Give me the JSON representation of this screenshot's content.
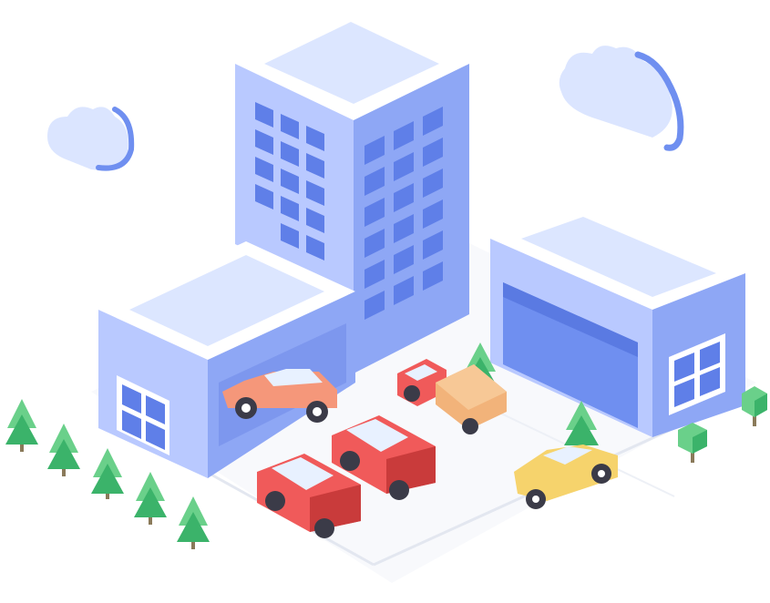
{
  "scene": {
    "description_free": true,
    "palette": {
      "background": "#ffffff",
      "ground": "#f7f8fb",
      "ground_line": "#e6e9f2",
      "building_top": "#dce6ff",
      "building_top_rim": "#eef3ff",
      "building_left": "#b9c9ff",
      "building_right": "#8ea7f5",
      "window": "#5f7fe8",
      "window_frame": "#ffffff",
      "cloud": "#dbe5ff",
      "cloud_shadow": "#6f8ff0",
      "tree_light": "#6ad08a",
      "tree_dark": "#3bb36a",
      "trunk": "#8a7a5a",
      "car_red": "#f05a5a",
      "car_red_dark": "#c93b3b",
      "car_coral": "#f5977a",
      "car_yellow": "#f6d36c",
      "truck_body": "#f2b37a",
      "glass": "#e8f1ff",
      "tire": "#3b3b48"
    },
    "icons": {
      "clouds": "cloud-icon",
      "trees": "tree-icon",
      "cars": "car-icon",
      "truck": "truck-icon",
      "buildings": "building-icon"
    }
  }
}
